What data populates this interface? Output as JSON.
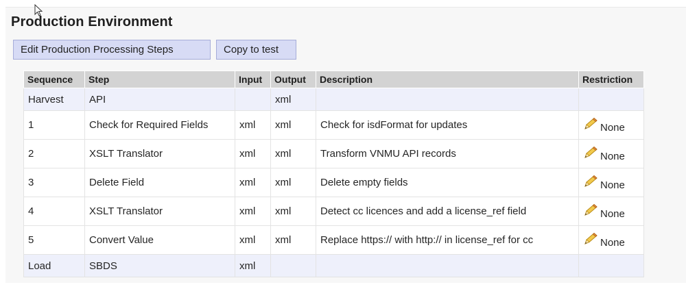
{
  "page": {
    "title": "Production Environment"
  },
  "toolbar": {
    "edit_label": "Edit Production Processing Steps",
    "copy_label": "Copy to test"
  },
  "table": {
    "headers": {
      "sequence": "Sequence",
      "step": "Step",
      "input": "Input",
      "output": "Output",
      "description": "Description",
      "restriction": "Restriction"
    },
    "rows": [
      {
        "sequence": "Harvest",
        "step": "API",
        "input": "",
        "output": "xml",
        "description": "",
        "restriction": ""
      },
      {
        "sequence": "1",
        "step": "Check for Required Fields",
        "input": "xml",
        "output": "xml",
        "description": "Check for isdFormat for updates",
        "restriction": "None"
      },
      {
        "sequence": "2",
        "step": "XSLT Translator",
        "input": "xml",
        "output": "xml",
        "description": "Transform VNMU API records",
        "restriction": "None"
      },
      {
        "sequence": "3",
        "step": "Delete Field",
        "input": "xml",
        "output": "xml",
        "description": "Delete empty fields",
        "restriction": "None"
      },
      {
        "sequence": "4",
        "step": "XSLT Translator",
        "input": "xml",
        "output": "xml",
        "description": "Detect cc licences and add a license_ref field",
        "restriction": "None"
      },
      {
        "sequence": "5",
        "step": "Convert Value",
        "input": "xml",
        "output": "xml",
        "description": "Replace https:// with http:// in license_ref for cc",
        "restriction": "None"
      },
      {
        "sequence": "Load",
        "step": "SBDS",
        "input": "xml",
        "output": "",
        "description": "",
        "restriction": ""
      }
    ]
  },
  "icons": {
    "edit": "pencil-icon",
    "cursor": "mouse-pointer-icon"
  },
  "colors": {
    "button_bg": "#d7dbf5",
    "header_bg": "#d3d3d3",
    "edge_row_bg": "#eef0fb",
    "pencil": "#e8b830"
  }
}
